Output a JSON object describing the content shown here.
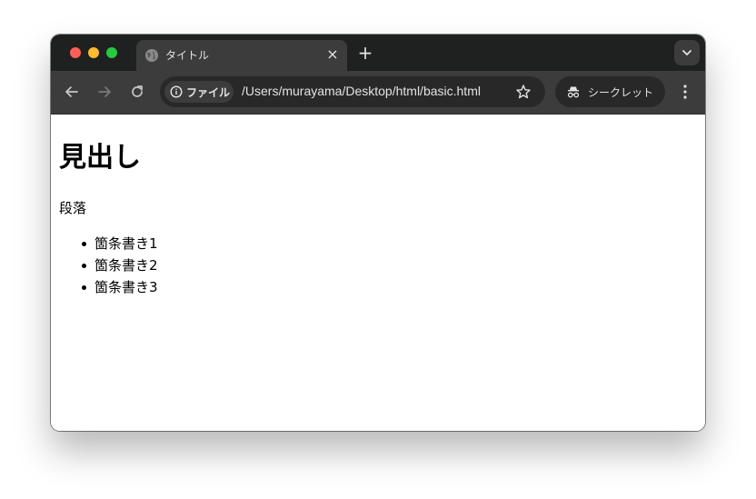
{
  "browser": {
    "tab": {
      "title": "タイトル"
    },
    "address_bar": {
      "chip_label": "ファイル",
      "url": "/Users/murayama/Desktop/html/basic.html"
    },
    "incognito_label": "シークレット",
    "theme": {
      "frame": "#1f2020",
      "toolbar": "#3c3c3c",
      "omnibox": "#282828",
      "text": "#e3e3e3"
    }
  },
  "page": {
    "heading": "見出し",
    "paragraph": "段落",
    "list_items": [
      "箇条書き1",
      "箇条書き2",
      "箇条書き3"
    ]
  }
}
